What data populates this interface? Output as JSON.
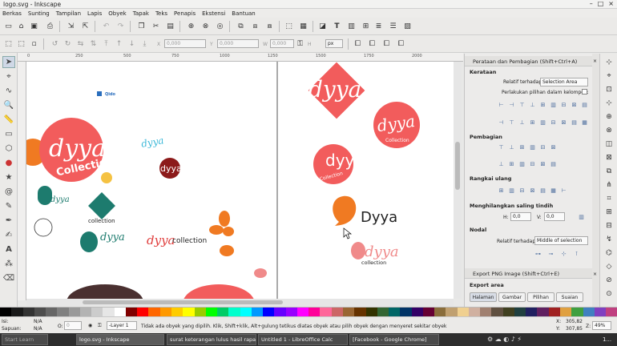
{
  "window": {
    "title": "logo.svg - Inkscape"
  },
  "menu": [
    "Berkas",
    "Sunting",
    "Tampilan",
    "Lapis",
    "Obyek",
    "Tapak",
    "Teks",
    "Penapis",
    "Ekstensi",
    "Bantuan"
  ],
  "toolbar2": {
    "x_value": "0,000",
    "y_value": "0,000",
    "w_value": "0,000",
    "h_value": "0,000",
    "unit": "px"
  },
  "ruler": {
    "h_ticks": [
      "0",
      "250",
      "500",
      "750",
      "1000",
      "1250",
      "1500",
      "1750",
      "2000"
    ]
  },
  "canvas": {
    "texts": {
      "qido": "Qido",
      "dyya1": "dyya",
      "collection1": "Collectio",
      "dyya_small": "dyya",
      "dyya_circle": "dyya",
      "dyya_green": "dyya",
      "collection_green": "collection",
      "dyya_green2": "dyya",
      "dyya_red": "dyya",
      "collection_red": "collection",
      "dyya_r1": "dyya",
      "dyya_r2": "dyya",
      "collection_r2": "Collection",
      "dyya_r3": "dyya",
      "collection_r3": "Collection",
      "dyya_orange": "Dyya",
      "dyya_pink": "dyya",
      "collection_pink": "collection"
    }
  },
  "panel": {
    "title": "Perataan dan Pembagian (Shift+Ctrl+A)",
    "kerataan": "Kerataan",
    "relatif_label": "Relatif terhadap:",
    "relatif_value": "Selection Area",
    "perlakukan": "Perlakukan pilihan dalam kelompok:",
    "pembagian": "Pembagian",
    "rangkai": "Rangkai ulang",
    "menghilangkan": "Menghilangkan saling tindih",
    "h_label": "H:",
    "h_value": "0,0",
    "v_label": "V:",
    "v_value": "0,0",
    "nodal": "Nodal",
    "nodal_relatif_label": "Relatif terhadap:",
    "nodal_relatif_value": "Middle of selection",
    "export_title": "Export PNG Image (Shift+Ctrl+E)",
    "export_area": "Export area",
    "export_buttons": [
      "Halaman",
      "Gambar",
      "Pilihan",
      "Suaian"
    ]
  },
  "status": {
    "fill_label": "Isi:",
    "stroke_label": "Sapuan:",
    "fill_value": "N/A",
    "stroke_value": "N/A",
    "opacity_label": "O:",
    "opacity_value": "0",
    "layer": "-Layer 1",
    "message": "Tidak ada obyek yang dipilih. Klik, Shift+klik, Alt+gulung tetikus diatas obyek atau pilih obyek dengan menyeret sekitar obyek",
    "x_label": "X:",
    "x_value": "305,82",
    "y_label": "Y:",
    "y_value": "307,85",
    "z_label": "Z:",
    "zoom": "49%"
  },
  "taskbar": {
    "items": [
      "Start Learn",
      "logo.svg - Inkscape",
      "surat keterangan lulus hasil rapat ...",
      "Untitled 1 - LibreOffice Calc",
      "[Facebook - Google Chrome]"
    ],
    "clock": "1..."
  },
  "palette": [
    "#000000",
    "#1a1a1a",
    "#333333",
    "#4d4d4d",
    "#666666",
    "#808080",
    "#999999",
    "#b3b3b3",
    "#cccccc",
    "#e6e6e6",
    "#ffffff",
    "#800000",
    "#ff0000",
    "#ff6600",
    "#ff9900",
    "#ffcc00",
    "#ffff00",
    "#99cc00",
    "#00ff00",
    "#00cc66",
    "#00ffcc",
    "#00ffff",
    "#0099ff",
    "#0000ff",
    "#6600ff",
    "#9900ff",
    "#ff00ff",
    "#ff0099",
    "#ff6699",
    "#cc6666",
    "#996633",
    "#663300",
    "#333300",
    "#336633",
    "#006666",
    "#003366",
    "#330066",
    "#660033",
    "#8a6d3b",
    "#c0a070",
    "#f0d090",
    "#d0b0a0",
    "#a08070",
    "#605040",
    "#404020",
    "#204040",
    "#202060",
    "#602060",
    "#a02020",
    "#e0a040",
    "#40a040",
    "#4080c0",
    "#8040c0",
    "#c04080"
  ],
  "colors": {
    "coral": "#f25c5c",
    "teal": "#1d7b6e",
    "orange": "#f07a22",
    "darkred": "#8c1a1a",
    "cyan": "#3cb8d8",
    "pink": "#f08a8a"
  }
}
